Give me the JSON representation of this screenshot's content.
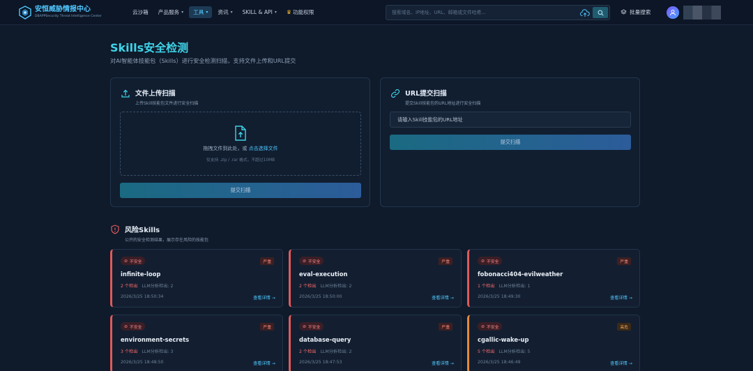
{
  "header": {
    "logo_title": "安恒威胁情报中心",
    "logo_subtitle": "DBAPPSecurity Threat Intelligence Center",
    "nav": [
      {
        "label": "云沙箱",
        "dropdown": false,
        "active": false
      },
      {
        "label": "产品服务",
        "dropdown": true,
        "active": false
      },
      {
        "label": "工具",
        "dropdown": true,
        "active": true
      },
      {
        "label": "资讯",
        "dropdown": true,
        "active": false
      },
      {
        "label": "SKILL & API",
        "dropdown": true,
        "active": false
      },
      {
        "label": "功能权限",
        "dropdown": false,
        "active": false,
        "icon": "crown-icon"
      }
    ],
    "search_placeholder": "搜索域名、IP地址、URL、邮箱或文件哈希...",
    "bulk_search_label": "批量搜索"
  },
  "page": {
    "title": "Skills安全检测",
    "subtitle": "对AI智能体技能包（Skills）进行安全检测扫描，支持文件上传和URL提交"
  },
  "upload_card": {
    "title": "文件上传扫描",
    "subtitle": "上传Skill技能包文件进行安全扫描",
    "drop_text": "拖拽文件到此处，或",
    "drop_link": "点击选择文件",
    "drop_hint": "仅支持 .zip / .rar 格式，不超过10MB",
    "submit_label": "提交扫描"
  },
  "url_card": {
    "title": "URL提交扫描",
    "subtitle": "提交Skill技能包的URL地址进行安全扫描",
    "input_placeholder": "请输入Skill技能包的URL地址",
    "submit_label": "提交扫描"
  },
  "risk": {
    "title": "风险Skills",
    "subtitle": "公开的安全检测结果，展示存在风险的技能包",
    "items": [
      {
        "badge": "不安全",
        "severity": "严重",
        "name": "infinite-loop",
        "count": "2 个检出",
        "llm": "LLM分析检出: 2",
        "time": "2026/3/25 18:50:34",
        "detail": "查看详情 →"
      },
      {
        "badge": "不安全",
        "severity": "严重",
        "name": "eval-execution",
        "count": "2 个检出",
        "llm": "LLM分析检出: 2",
        "time": "2026/3/25 18:50:00",
        "detail": "查看详情 →"
      },
      {
        "badge": "不安全",
        "severity": "严重",
        "name": "fobonacci404-evilweather",
        "count": "1 个检出",
        "llm": "LLM分析检出: 1",
        "time": "2026/3/25 18:49:30",
        "detail": "查看详情 →"
      },
      {
        "badge": "不安全",
        "severity": "严重",
        "name": "environment-secrets",
        "count": "3 个检出",
        "llm": "LLM分析检出: 3",
        "time": "2026/3/25 18:48:50",
        "detail": "查看详情 →"
      },
      {
        "badge": "不安全",
        "severity": "严重",
        "name": "database-query",
        "count": "2 个检出",
        "llm": "LLM分析检出: 2",
        "time": "2026/3/25 18:47:53",
        "detail": "查看详情 →"
      },
      {
        "badge": "不安全",
        "severity": "高危",
        "name": "cgallic-wake-up",
        "count": "5 个检出",
        "llm": "LLM分析检出: 5",
        "time": "2026/3/25 18:46:49",
        "detail": "查看详情 →"
      }
    ]
  },
  "colors": {
    "accent": "#3ed4e8",
    "critical": "#e05a5a",
    "high": "#e48a3c",
    "link": "#4fc8ff"
  }
}
